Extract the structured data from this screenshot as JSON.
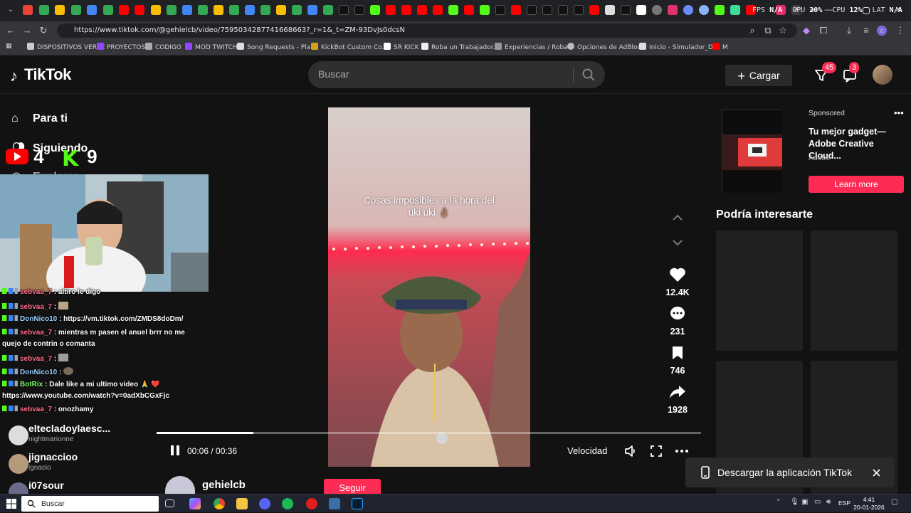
{
  "browser": {
    "url": "https://www.tiktok.com/@gehielcb/video/7595034287741668663?_r=1&_t=ZM-93DvJs0dcsN",
    "overlay_stats": {
      "fps_label": "FPS",
      "fps_value": "N/A",
      "gpu_label": "GPU",
      "gpu_value": "20%",
      "cpu_label": "CPU",
      "cpu_value": "12%",
      "lat_label": "LAT",
      "lat_value": "N/A"
    },
    "bookmarks": [
      "DISPOSITIVOS VERSE",
      "PROYECTOS",
      "CODIGO",
      "MOD TWITCH",
      "Song Requests - Pla...",
      "KickBot Custom Co...",
      "SR KICK",
      "Roba un Trabajador...",
      "Experiencias / Roba...",
      "Opciones de AdBlock",
      "Inicio - Simulador_D...",
      "M"
    ]
  },
  "tiktok": {
    "logo": "TikTok",
    "search_placeholder": "Buscar",
    "upload_label": "Cargar",
    "inbox_badge": "45",
    "messages_badge": "3"
  },
  "sidebar": {
    "nav": [
      "Para ti",
      "Siguiendo",
      "Explorar"
    ],
    "following": [
      {
        "name": "eltecladoylaesc...",
        "sub": "nightmarionne"
      },
      {
        "name": "jignaccioo",
        "sub": "ignacio"
      },
      {
        "name": "i07sour",
        "sub": ""
      }
    ]
  },
  "stream": {
    "counter_left": "4",
    "counter_right": "9",
    "chat": [
      {
        "user": "sebvaa_7",
        "text": ": altiro le digo"
      },
      {
        "user": "sebvaa_7",
        "text": ":"
      },
      {
        "user": "DonNico10",
        "text": ": https://vm.tiktok.com/ZMDS8doDm/"
      },
      {
        "user": "sebvaa_7",
        "text": ": mientras m pasen el anuel brrr no me"
      },
      {
        "user": "",
        "text": "quejo de contrin o comanta"
      },
      {
        "user": "sebvaa_7",
        "text": ":"
      },
      {
        "user": "DonNico10",
        "text": ":"
      },
      {
        "user": "BotRix",
        "text": ": Dale like a mi ultimo video 🙏 ❤️"
      },
      {
        "user": "",
        "text": "https://www.youtube.com/watch?v=0adXbCGxFjc"
      },
      {
        "user": "sebvaa_7",
        "text": ": onozhamy"
      }
    ]
  },
  "video": {
    "caption_line1": "Cosas imposibles a la hora del",
    "caption_line2": "uki uki 👌🏽",
    "time": "00:06 / 00:36",
    "progress": 0.178,
    "speed_label": "Velocidad"
  },
  "actions": {
    "likes": "12.4K",
    "comments": "231",
    "saves": "746",
    "shares": "1928"
  },
  "ad": {
    "sponsored": "Sponsored",
    "title": "Tu mejor gadget— Adobe Creative Cloud...",
    "brand": "Adobe",
    "cta": "Learn more"
  },
  "recommend": {
    "title": "Podría interesarte"
  },
  "author": {
    "name": "gehielcb",
    "follow": "Seguir"
  },
  "download_banner": "Descargar la aplicación TikTok",
  "taskbar": {
    "search": "Buscar",
    "lang": "ESP",
    "time": "4:41",
    "date": "20-01-2026"
  },
  "colors": {
    "accent": "#fe2c55",
    "kick_green": "#53fc18",
    "youtube_red": "#ff0000"
  }
}
